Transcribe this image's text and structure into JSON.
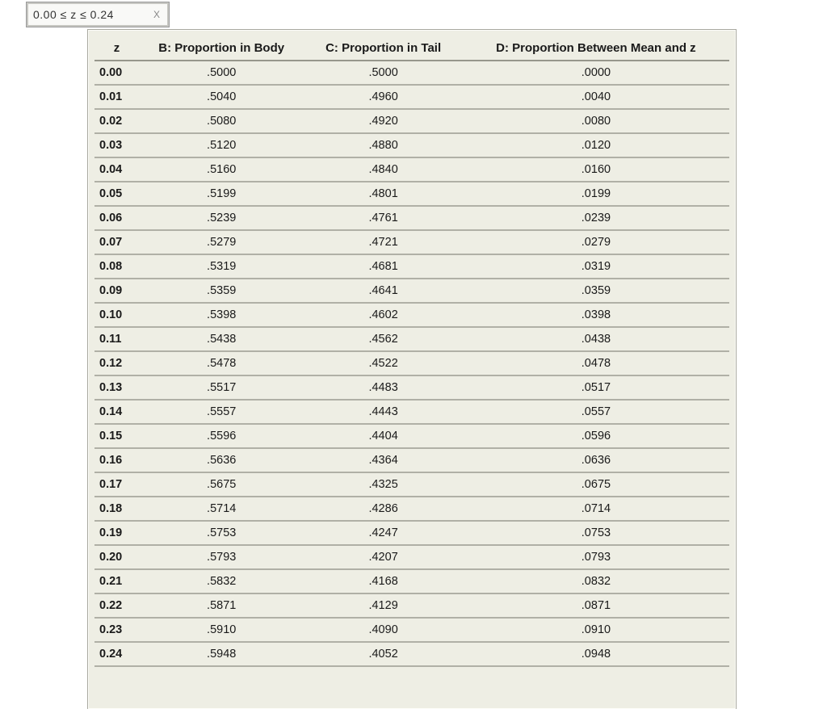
{
  "tab": {
    "label": "0.00 ≤ z ≤ 0.24",
    "close_glyph": "X"
  },
  "headers": {
    "z": "z",
    "b": "B: Proportion in Body",
    "c": "C: Proportion in Tail",
    "d": "D: Proportion Between Mean and z"
  },
  "rows": [
    {
      "z": "0.00",
      "b": ".5000",
      "c": ".5000",
      "d": ".0000"
    },
    {
      "z": "0.01",
      "b": ".5040",
      "c": ".4960",
      "d": ".0040"
    },
    {
      "z": "0.02",
      "b": ".5080",
      "c": ".4920",
      "d": ".0080"
    },
    {
      "z": "0.03",
      "b": ".5120",
      "c": ".4880",
      "d": ".0120"
    },
    {
      "z": "0.04",
      "b": ".5160",
      "c": ".4840",
      "d": ".0160"
    },
    {
      "z": "0.05",
      "b": ".5199",
      "c": ".4801",
      "d": ".0199"
    },
    {
      "z": "0.06",
      "b": ".5239",
      "c": ".4761",
      "d": ".0239"
    },
    {
      "z": "0.07",
      "b": ".5279",
      "c": ".4721",
      "d": ".0279"
    },
    {
      "z": "0.08",
      "b": ".5319",
      "c": ".4681",
      "d": ".0319"
    },
    {
      "z": "0.09",
      "b": ".5359",
      "c": ".4641",
      "d": ".0359"
    },
    {
      "z": "0.10",
      "b": ".5398",
      "c": ".4602",
      "d": ".0398"
    },
    {
      "z": "0.11",
      "b": ".5438",
      "c": ".4562",
      "d": ".0438"
    },
    {
      "z": "0.12",
      "b": ".5478",
      "c": ".4522",
      "d": ".0478"
    },
    {
      "z": "0.13",
      "b": ".5517",
      "c": ".4483",
      "d": ".0517"
    },
    {
      "z": "0.14",
      "b": ".5557",
      "c": ".4443",
      "d": ".0557"
    },
    {
      "z": "0.15",
      "b": ".5596",
      "c": ".4404",
      "d": ".0596"
    },
    {
      "z": "0.16",
      "b": ".5636",
      "c": ".4364",
      "d": ".0636"
    },
    {
      "z": "0.17",
      "b": ".5675",
      "c": ".4325",
      "d": ".0675"
    },
    {
      "z": "0.18",
      "b": ".5714",
      "c": ".4286",
      "d": ".0714"
    },
    {
      "z": "0.19",
      "b": ".5753",
      "c": ".4247",
      "d": ".0753"
    },
    {
      "z": "0.20",
      "b": ".5793",
      "c": ".4207",
      "d": ".0793"
    },
    {
      "z": "0.21",
      "b": ".5832",
      "c": ".4168",
      "d": ".0832"
    },
    {
      "z": "0.22",
      "b": ".5871",
      "c": ".4129",
      "d": ".0871"
    },
    {
      "z": "0.23",
      "b": ".5910",
      "c": ".4090",
      "d": ".0910"
    },
    {
      "z": "0.24",
      "b": ".5948",
      "c": ".4052",
      "d": ".0948"
    }
  ]
}
